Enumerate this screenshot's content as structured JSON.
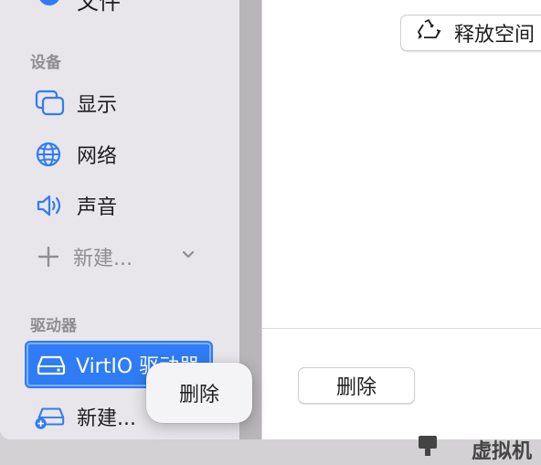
{
  "sidebar": {
    "top_partial_label": "文件",
    "sections": {
      "devices": "设备",
      "drives": "驱动器"
    },
    "device_items": [
      {
        "label": "显示",
        "icon": "display-icon"
      },
      {
        "label": "网络",
        "icon": "globe-icon"
      },
      {
        "label": "声音",
        "icon": "speaker-icon"
      }
    ],
    "add_device_label": "新建...",
    "drive_items": [
      {
        "label": "VirtIO 驱动器",
        "icon": "drive-icon",
        "selected": true
      }
    ],
    "new_drive_label": "新建..."
  },
  "main": {
    "free_space_label": "释放空间",
    "delete_label": "删除"
  },
  "context_menu": {
    "delete_label": "删除"
  },
  "dock": {
    "partial_label": "虚拟机"
  },
  "colors": {
    "accent": "#2f7cf6",
    "sidebar_bg": "#e8e6ea",
    "section_header": "#8f8d91"
  }
}
